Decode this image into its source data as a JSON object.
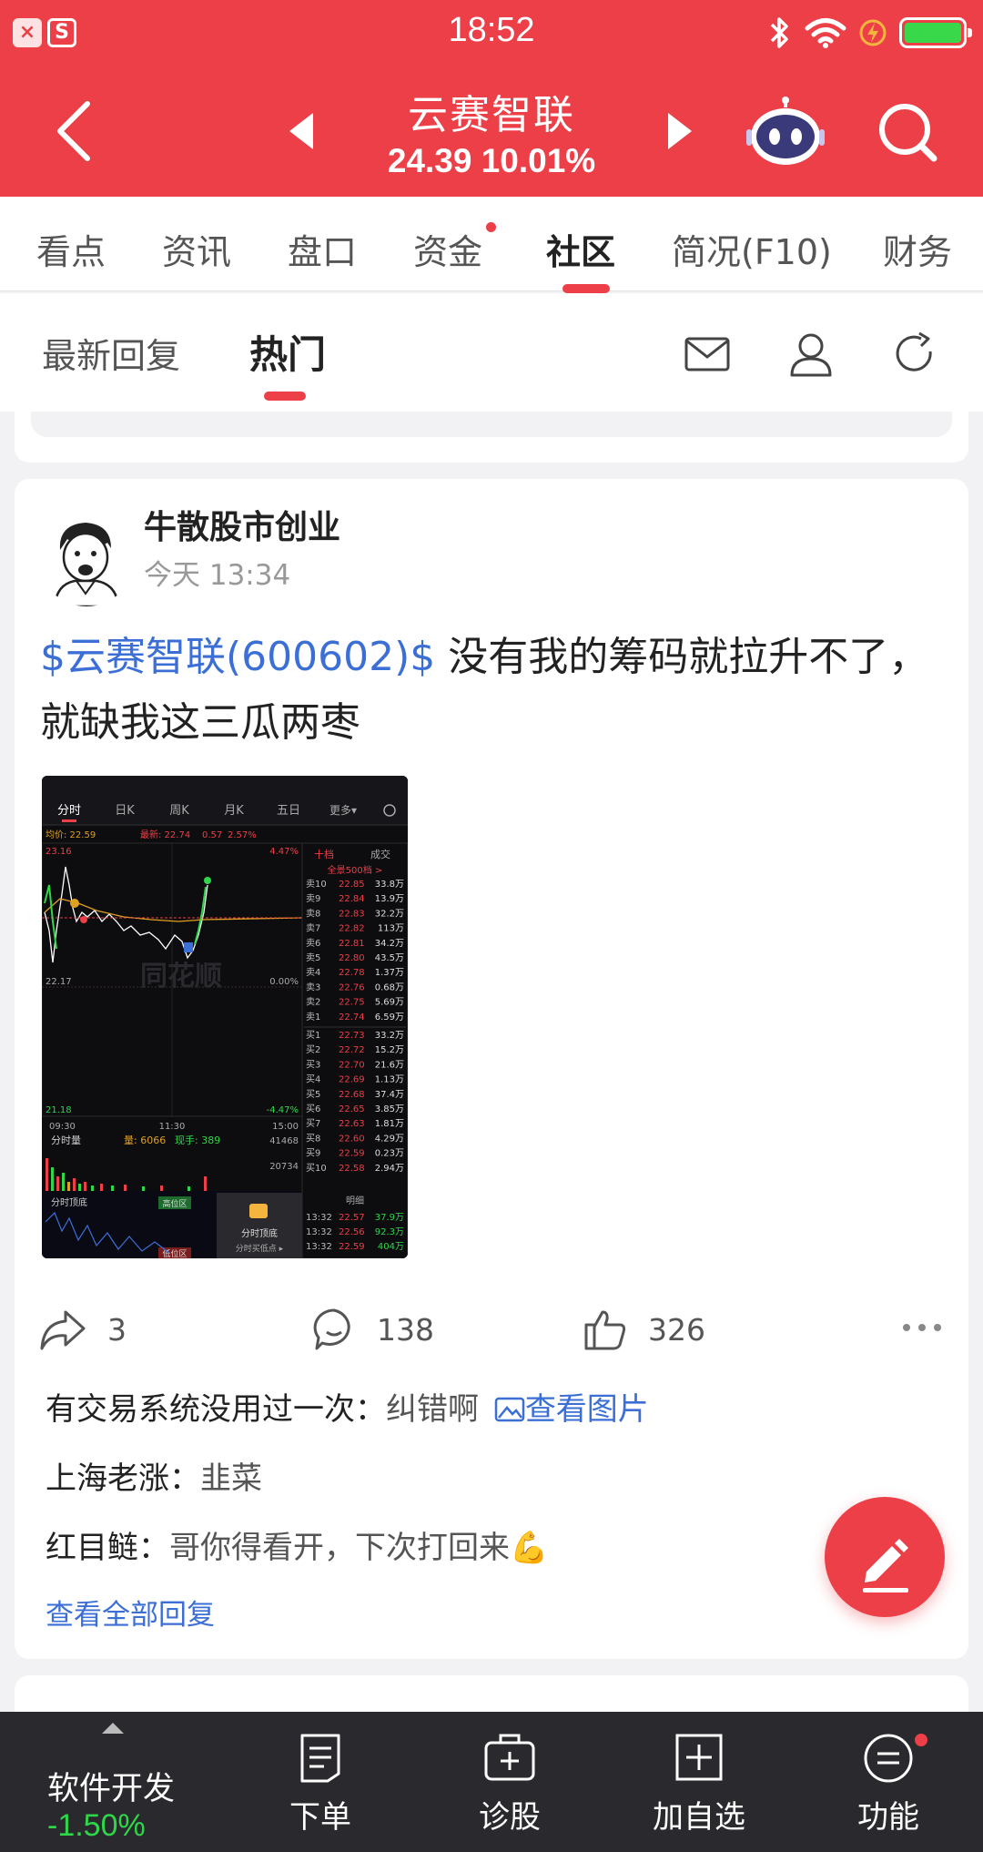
{
  "status_bar": {
    "time": "18:52",
    "app_icon_1": "×",
    "app_icon_2": "S"
  },
  "header": {
    "title": "云赛智联",
    "price_line": "24.39 10.01%",
    "bg_color": "#ec3f47"
  },
  "tabs": [
    {
      "label": "看点",
      "active": false
    },
    {
      "label": "资讯",
      "active": false
    },
    {
      "label": "盘口",
      "active": false
    },
    {
      "label": "资金",
      "active": false,
      "dot": true
    },
    {
      "label": "社区",
      "active": true
    },
    {
      "label": "简况(F10)",
      "active": false
    },
    {
      "label": "财务",
      "active": false
    }
  ],
  "subtabs": [
    {
      "label": "最新回复",
      "active": false
    },
    {
      "label": "热门",
      "active": true
    }
  ],
  "post": {
    "author": "牛散股市创业",
    "time": "今天 13:34",
    "stock_tag": "$云赛智联(600602)$",
    "body_text": "没有我的筹码就拉升不了，就缺我这三瓜两枣",
    "actions": {
      "share_count": "3",
      "comment_count": "138",
      "like_count": "326"
    },
    "comments": [
      {
        "user": "有交易系统没用过一次：",
        "text": "纠错啊",
        "link": "查看图片"
      },
      {
        "user": "上海老涨：",
        "text": "韭菜"
      },
      {
        "user": "红目鲢：",
        "text": "哥你得看开，下次打回来💪"
      }
    ],
    "all_replies": "查看全部回复"
  },
  "thumbnail": {
    "tabs": [
      "分时",
      "日K",
      "周K",
      "月K",
      "五日",
      "更多▾"
    ],
    "avg_line": "均价: 22.59",
    "latest": "最新: 22.74",
    "change": "0.57",
    "change_pct": "2.57%",
    "price_high": "23.16",
    "price_mid": "22.17",
    "price_low": "21.18",
    "pct_high": "4.47%",
    "pct_mid": "0.00%",
    "pct_low": "-4.47%",
    "time_start": "09:30",
    "time_mid": "11:30",
    "time_end": "15:00",
    "vol_label": "分时量",
    "vol_value": "量: 6066",
    "vol_hand": "现手: 389",
    "vol_axis_high": "41468",
    "vol_axis_mid": "20734",
    "indicator_label": "分时顶底",
    "indicator_high_zone": "高位区",
    "indicator_low_zone": "低位区",
    "popup_label": "分时顶底",
    "popup_sub": "分时买低点 ▸",
    "watermark": "同花顺",
    "ob_tab_1": "十档",
    "ob_tab_2": "成交",
    "ob_all": "全景500档 >",
    "asks": [
      {
        "label": "卖10",
        "price": "22.85",
        "vol": "33.8万"
      },
      {
        "label": "卖9",
        "price": "22.84",
        "vol": "13.9万"
      },
      {
        "label": "卖8",
        "price": "22.83",
        "vol": "32.2万"
      },
      {
        "label": "卖7",
        "price": "22.82",
        "vol": "113万"
      },
      {
        "label": "卖6",
        "price": "22.81",
        "vol": "34.2万"
      },
      {
        "label": "卖5",
        "price": "22.80",
        "vol": "43.5万"
      },
      {
        "label": "卖4",
        "price": "22.78",
        "vol": "1.37万"
      },
      {
        "label": "卖3",
        "price": "22.76",
        "vol": "0.68万"
      },
      {
        "label": "卖2",
        "price": "22.75",
        "vol": "5.69万"
      },
      {
        "label": "卖1",
        "price": "22.74",
        "vol": "6.59万"
      }
    ],
    "bids": [
      {
        "label": "买1",
        "price": "22.73",
        "vol": "33.2万"
      },
      {
        "label": "买2",
        "price": "22.72",
        "vol": "15.2万"
      },
      {
        "label": "买3",
        "price": "22.70",
        "vol": "21.6万"
      },
      {
        "label": "买4",
        "price": "22.69",
        "vol": "1.13万"
      },
      {
        "label": "买5",
        "price": "22.68",
        "vol": "37.4万"
      },
      {
        "label": "买6",
        "price": "22.65",
        "vol": "3.85万"
      },
      {
        "label": "买7",
        "price": "22.63",
        "vol": "1.81万"
      },
      {
        "label": "买8",
        "price": "22.60",
        "vol": "4.29万"
      },
      {
        "label": "买9",
        "price": "22.59",
        "vol": "0.23万"
      },
      {
        "label": "买10",
        "price": "22.58",
        "vol": "2.94万"
      }
    ],
    "detail_label": "明细",
    "trades": [
      {
        "time": "13:32",
        "price": "22.57",
        "vol": "37.9万"
      },
      {
        "time": "13:32",
        "price": "22.56",
        "vol": "92.3万"
      },
      {
        "time": "13:32",
        "price": "22.59",
        "vol": "404万"
      }
    ]
  },
  "bottom_bar": {
    "stock_name": "软件开发",
    "stock_pct": "-1.50%",
    "items": [
      "下单",
      "诊股",
      "加自选",
      "功能"
    ]
  },
  "icons": [
    "back-icon",
    "prev-stock-icon",
    "next-stock-icon",
    "robot-assistant-icon",
    "search-icon",
    "mail-icon",
    "user-icon",
    "refresh-icon",
    "share-icon",
    "comment-icon",
    "like-icon",
    "more-icon",
    "edit-icon",
    "order-icon",
    "diagnose-icon",
    "add-watchlist-icon",
    "function-icon",
    "image-icon"
  ]
}
